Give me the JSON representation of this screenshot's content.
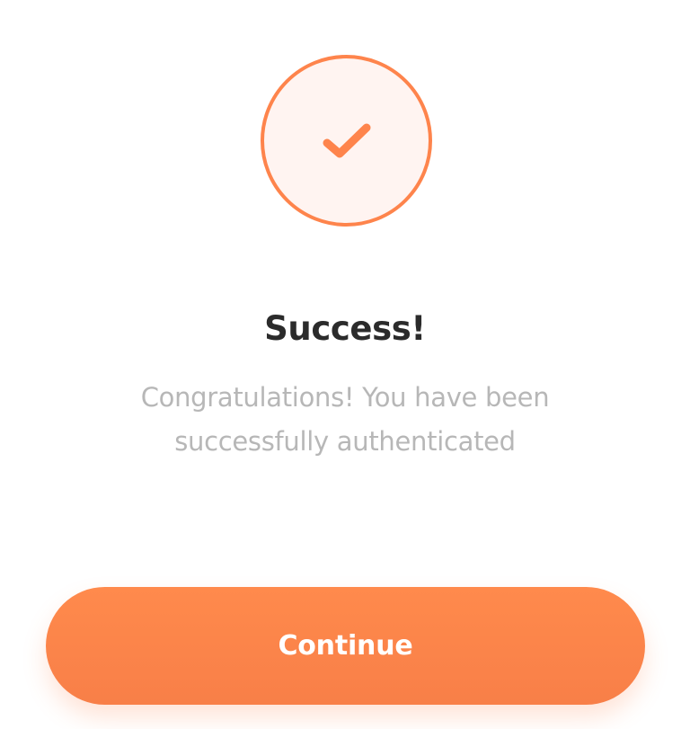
{
  "success_screen": {
    "icon": "check-icon",
    "title": "Success!",
    "message": "Congratulations! You have been successfully authenticated",
    "continue_label": "Continue"
  },
  "colors": {
    "accent": "#fe844c",
    "badge_fill": "#fff4f1",
    "title": "#2b2b2b",
    "message": "#b7b7b7",
    "button_text": "#ffffff"
  }
}
